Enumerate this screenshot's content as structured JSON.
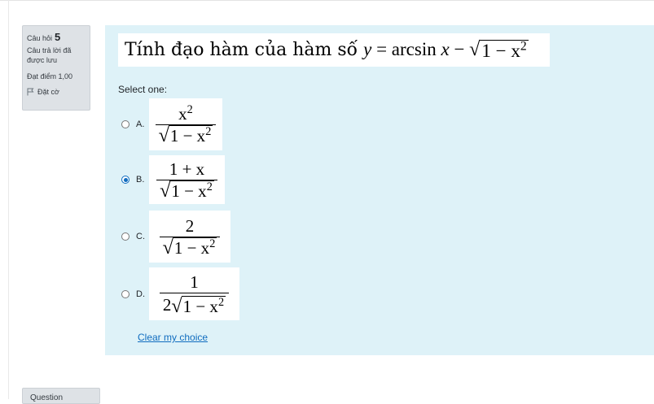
{
  "question_info": {
    "label": "Câu hỏi",
    "number": "5",
    "state": "Câu trả lời đã được lưu",
    "grade": "Đạt điểm 1,00",
    "flag_label": "Đặt cờ",
    "flag_icon": "flag-icon"
  },
  "question": {
    "text_prefix": "Tính đạo hàm của hàm số",
    "formula_y": "y",
    "formula_eq": " = arcsin ",
    "formula_x": "x",
    "formula_minus": " − ",
    "formula_radicand": "1 − x²",
    "prompt": "Select one:"
  },
  "options": [
    {
      "letter": "A.",
      "numerator": "x²",
      "denominator": "1 − x²",
      "coefficient": "",
      "selected": false
    },
    {
      "letter": "B.",
      "numerator": "1 + x",
      "denominator": "1 − x²",
      "coefficient": "",
      "selected": true
    },
    {
      "letter": "C.",
      "numerator": "2",
      "denominator": "1 − x²",
      "coefficient": "",
      "selected": false
    },
    {
      "letter": "D.",
      "numerator": "1",
      "denominator": "1 − x²",
      "coefficient": "2",
      "selected": false
    }
  ],
  "clear_choice": "Clear my choice",
  "navigation_stub": "Question",
  "colors": {
    "accent": "#0f6cbf",
    "content_bg": "#def2f8",
    "info_bg": "#dee2e6"
  }
}
